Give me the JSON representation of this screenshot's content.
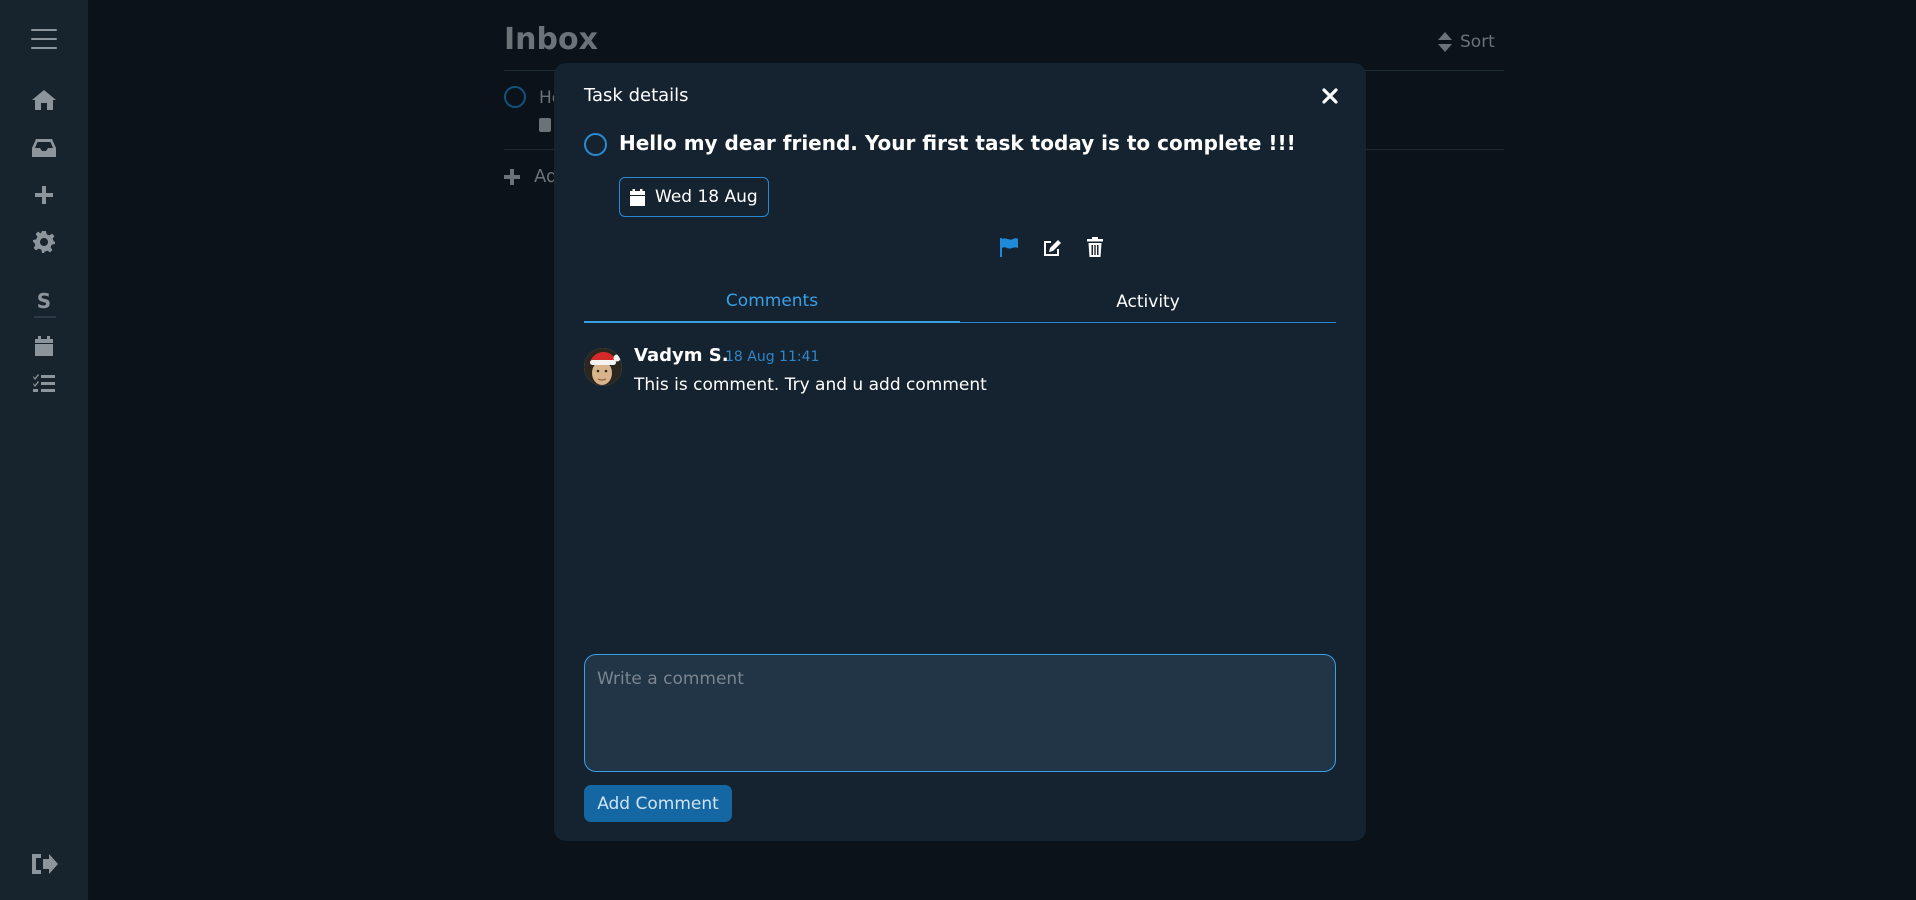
{
  "sidebar": {
    "letter": "S",
    "icons": [
      "menu-icon",
      "home-icon",
      "inbox-icon",
      "plus-icon",
      "gear-icon",
      "calendar-icon",
      "checklist-icon",
      "logout-icon"
    ]
  },
  "page": {
    "title": "Inbox",
    "sort_label": "Sort",
    "task_text": "He",
    "add_text": "Ad"
  },
  "modal": {
    "title": "Task details",
    "task_title": "Hello my dear friend. Your first task today is to complete !!!",
    "due_date": "Wed 18 Aug",
    "tabs": [
      {
        "label": "Comments",
        "active": true
      },
      {
        "label": "Activity",
        "active": false
      }
    ],
    "comments": [
      {
        "author": "Vadym S.",
        "time": "18 Aug 11:41",
        "text": "This is comment. Try and u add comment"
      }
    ],
    "comment_placeholder": "Write a comment",
    "add_comment_label": "Add Comment"
  },
  "colors": {
    "accent": "#2a8ad0",
    "modal_bg": "#152330",
    "page_bg": "#0b1219",
    "sidebar_bg": "#17232d"
  }
}
